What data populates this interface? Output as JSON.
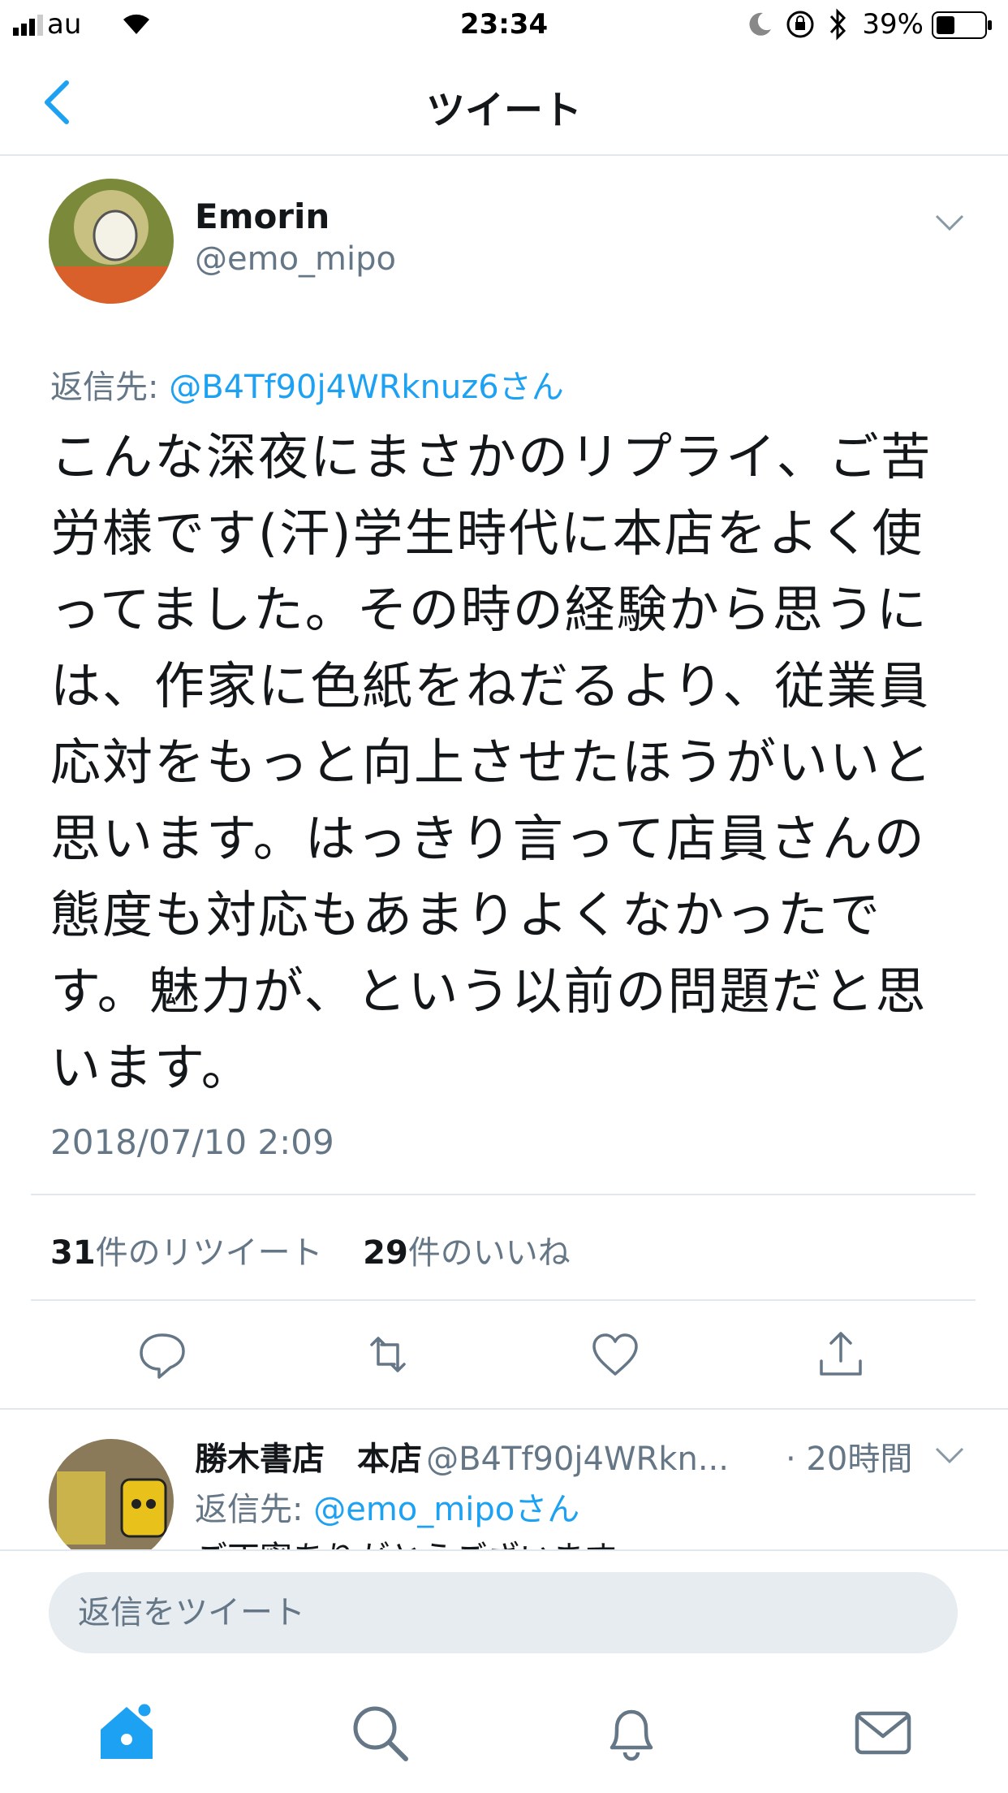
{
  "status_bar": {
    "carrier": "au",
    "time": "23:34",
    "battery": "39%"
  },
  "nav": {
    "title": "ツイート"
  },
  "tweet": {
    "name": "Emorin",
    "handle": "@emo_mipo",
    "replying_prefix": "返信先: ",
    "replying_to": "@B4Tf90j4WRknuz6さん",
    "lines": [
      "こんな深夜にまさかのリプライ、ご苦",
      "労様です(汗)学生時代に本店をよく使",
      "ってました。その時の経験から思うに",
      "は、作家に色紙をねだるより、従業員",
      "応対をもっと向上させたほうがいいと",
      "思います。はっきり言って店員さんの",
      "態度も対応もあまりよくなかったで",
      "す。魅力が、という以前の問題だと思",
      "います。"
    ],
    "timestamp": "2018/07/10 2:09",
    "retweet_count": "31",
    "retweet_label": "件のリツイート",
    "like_count": "29",
    "like_label": "件のいいね"
  },
  "reply": {
    "name": "勝木書店　本店",
    "handle": "@B4Tf90j4WRkn...",
    "time": "· 20時間",
    "replying_prefix": "返信先: ",
    "replying_to": "@emo_mipoさん",
    "partial_text": "ご丁寧ありがとうございます"
  },
  "compose": {
    "placeholder": "返信をツイート"
  },
  "colors": {
    "accent": "#1da1f2",
    "secondary_text": "#657786",
    "divider": "#e1e8ed",
    "compose_bg": "#e6ecf0"
  }
}
